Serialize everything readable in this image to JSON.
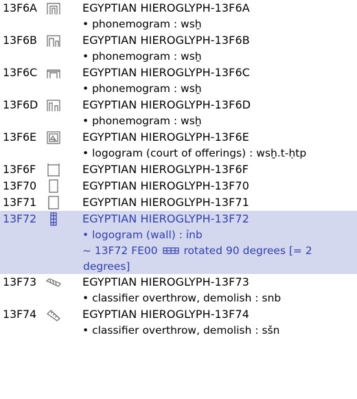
{
  "entries": [
    {
      "code": "13F6A",
      "glyph": "hieroglyph-13F6A",
      "name": "EGYPTIAN HIEROGLYPH-13F6A",
      "notes": [
        "• phonemogram : wsẖ"
      ]
    },
    {
      "code": "13F6B",
      "glyph": "hieroglyph-13F6B",
      "name": "EGYPTIAN HIEROGLYPH-13F6B",
      "notes": [
        "• phonemogram : wsẖ"
      ]
    },
    {
      "code": "13F6C",
      "glyph": "hieroglyph-13F6C",
      "name": "EGYPTIAN HIEROGLYPH-13F6C",
      "notes": [
        "• phonemogram : wsẖ"
      ]
    },
    {
      "code": "13F6D",
      "glyph": "hieroglyph-13F6D",
      "name": "EGYPTIAN HIEROGLYPH-13F6D",
      "notes": [
        "• phonemogram : wsẖ"
      ]
    },
    {
      "code": "13F6E",
      "glyph": "hieroglyph-13F6E",
      "name": "EGYPTIAN HIEROGLYPH-13F6E",
      "notes": [
        "• logogram (court of offerings) : wsẖ.t-ḥtp"
      ]
    },
    {
      "code": "13F6F",
      "glyph": "hieroglyph-13F6F",
      "name": "EGYPTIAN HIEROGLYPH-13F6F",
      "notes": []
    },
    {
      "code": "13F70",
      "glyph": "hieroglyph-13F70",
      "name": "EGYPTIAN HIEROGLYPH-13F70",
      "notes": []
    },
    {
      "code": "13F71",
      "glyph": "hieroglyph-13F71",
      "name": "EGYPTIAN HIEROGLYPH-13F71",
      "notes": []
    },
    {
      "code": "13F72",
      "glyph": "hieroglyph-13F72",
      "name": "EGYPTIAN HIEROGLYPH-13F72",
      "highlighted": true,
      "notes": [
        "• logogram (wall) : ỉnb"
      ],
      "variant": {
        "prefix": "~ 13F72 FE00",
        "suffix": "rotated 90 degrees [= 2",
        "continuation": "degrees]",
        "glyph": "rotated-hieroglyph-13F72"
      }
    },
    {
      "code": "13F73",
      "glyph": "hieroglyph-13F73",
      "name": "EGYPTIAN HIEROGLYPH-13F73",
      "notes": [
        "• classifier overthrow, demolish : snb"
      ]
    },
    {
      "code": "13F74",
      "glyph": "hieroglyph-13F74",
      "name": "EGYPTIAN HIEROGLYPH-13F74",
      "notes": [
        "• classifier overthrow, demolish : sšn"
      ]
    }
  ]
}
